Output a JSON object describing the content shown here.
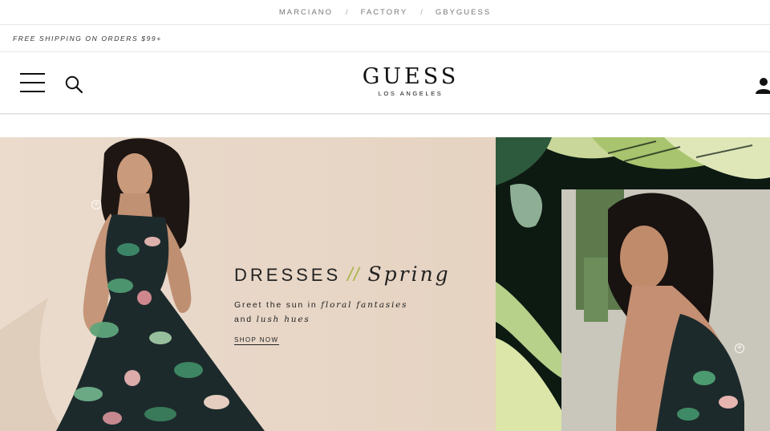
{
  "brandbar": {
    "links": [
      "MARCIANO",
      "FACTORY",
      "GBYGUESS"
    ],
    "separator": "/"
  },
  "promo": {
    "text": "FREE SHIPPING ON ORDERS $99+"
  },
  "header": {
    "logo_word": "GUESS",
    "logo_sub": "LOS ANGELES"
  },
  "hero": {
    "title_left": "DRESSES",
    "title_slash": "//",
    "title_right": "Spring",
    "sub_line1_a": "Greet the sun in ",
    "sub_line1_b": "floral fantasies",
    "sub_line2_a": "and ",
    "sub_line2_b": "lush hues",
    "cta": "SHOP NOW",
    "hotspot_symbol": "+"
  },
  "colors": {
    "hero_left_bg": "#e8d6c6",
    "accent_slash": "#a8b648",
    "hero_right_bg": "#0d1a12"
  },
  "icons": [
    "hamburger-menu-icon",
    "search-icon",
    "account-icon"
  ]
}
